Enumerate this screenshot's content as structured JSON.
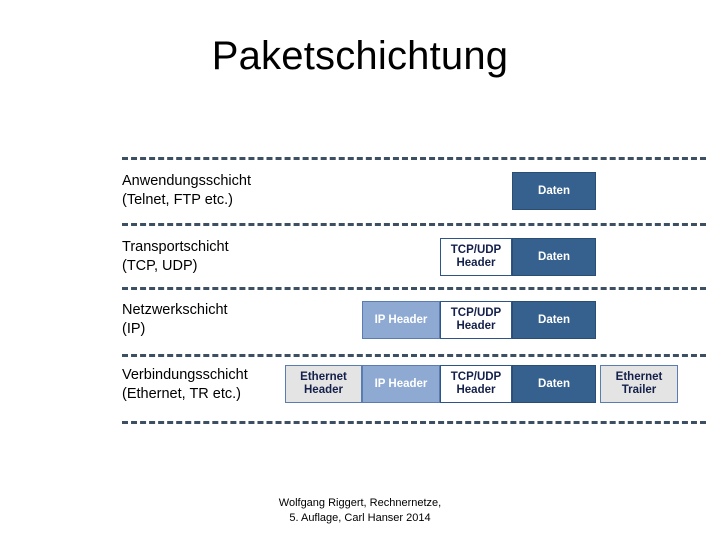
{
  "slide": {
    "title": "Paketschichtung",
    "footer": {
      "line1": "Wolfgang Riggert, Rechnernetze,",
      "line2": "5. Auflage, Carl Hanser 2014"
    }
  },
  "colors": {
    "rule": "#3d4f62",
    "daten_fill": "#36618f",
    "daten_text": "#ffffff",
    "header_fill": "#ffffff",
    "header_text": "#14204a",
    "ip_fill": "#8ea9d2",
    "ip_text": "#ffffff",
    "ethernet_fill": "#e4e4e4",
    "ethernet_text": "#14204a",
    "title_text": "#000000",
    "label_text": "#000000"
  },
  "layers": [
    {
      "name": "Anwendungsschicht",
      "protocols": "(Telnet, FTP etc.)"
    },
    {
      "name": "Transportschicht",
      "protocols": "(TCP, UDP)"
    },
    {
      "name": "Netzwerkschicht",
      "protocols": "(IP)"
    },
    {
      "name": "Verbindungsschicht",
      "protocols": "(Ethernet, TR etc.)"
    }
  ],
  "packets": {
    "row1": {
      "daten": "Daten"
    },
    "row2": {
      "tcp_udp_header": "TCP/UDP\nHeader",
      "daten": "Daten"
    },
    "row3": {
      "ip_header": "IP Header",
      "tcp_udp_header": "TCP/UDP\nHeader",
      "daten": "Daten"
    },
    "row4": {
      "ethernet_header": "Ethernet\nHeader",
      "ip_header": "IP Header",
      "tcp_udp_header": "TCP/UDP\nHeader",
      "daten": "Daten",
      "ethernet_trailer": "Ethernet\nTrailer"
    }
  }
}
